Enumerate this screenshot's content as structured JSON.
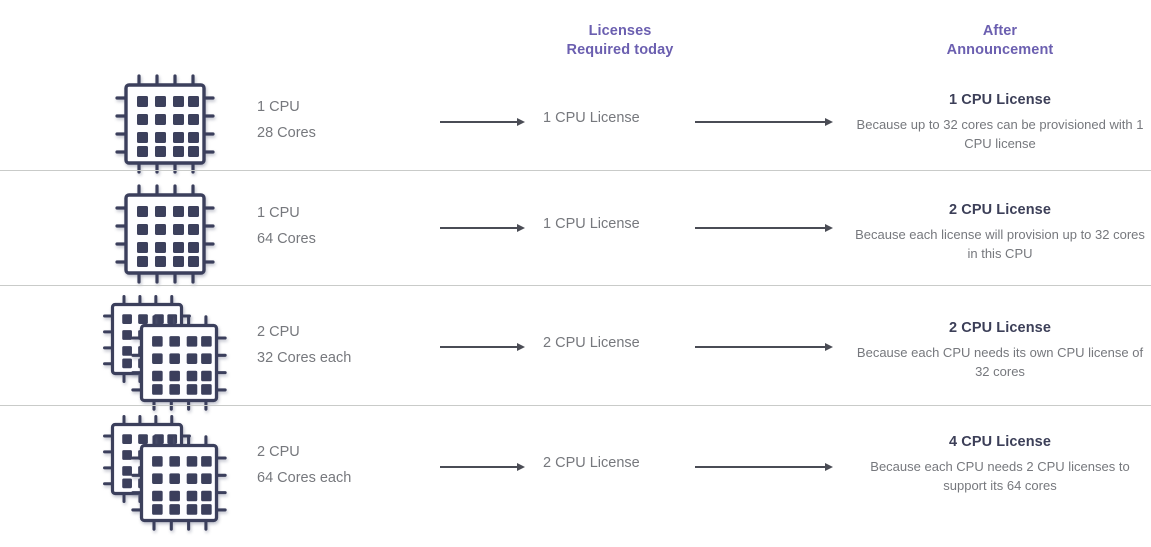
{
  "headers": {
    "middle": {
      "line1": "Licenses",
      "line2": "Required today"
    },
    "right": {
      "line1": "After",
      "line2": "Announcement"
    },
    "accent_color": "#6b5fb0"
  },
  "icons": {
    "chip": "cpu-chip-icon",
    "arrow": "arrow-right-icon"
  },
  "rows": [
    {
      "chip_count": 1,
      "spec": {
        "cpu": "1 CPU",
        "cores": "28 Cores"
      },
      "licenses_today": "1 CPU License",
      "after": {
        "title": "1 CPU License",
        "description": "Because up to 32 cores can be provisioned with 1 CPU license"
      }
    },
    {
      "chip_count": 1,
      "spec": {
        "cpu": "1 CPU",
        "cores": "64 Cores"
      },
      "licenses_today": "1 CPU License",
      "after": {
        "title": "2 CPU License",
        "description": "Because each license will provision up to 32 cores in this CPU"
      }
    },
    {
      "chip_count": 2,
      "spec": {
        "cpu": "2 CPU",
        "cores": "32 Cores each"
      },
      "licenses_today": "2 CPU License",
      "after": {
        "title": "2 CPU License",
        "description": "Because each CPU needs its own CPU license of 32 cores"
      }
    },
    {
      "chip_count": 2,
      "spec": {
        "cpu": "2 CPU",
        "cores": "64 Cores each"
      },
      "licenses_today": "2 CPU License",
      "after": {
        "title": "4 CPU License",
        "description": "Because each CPU needs 2 CPU licenses to support its 64 cores"
      }
    }
  ]
}
